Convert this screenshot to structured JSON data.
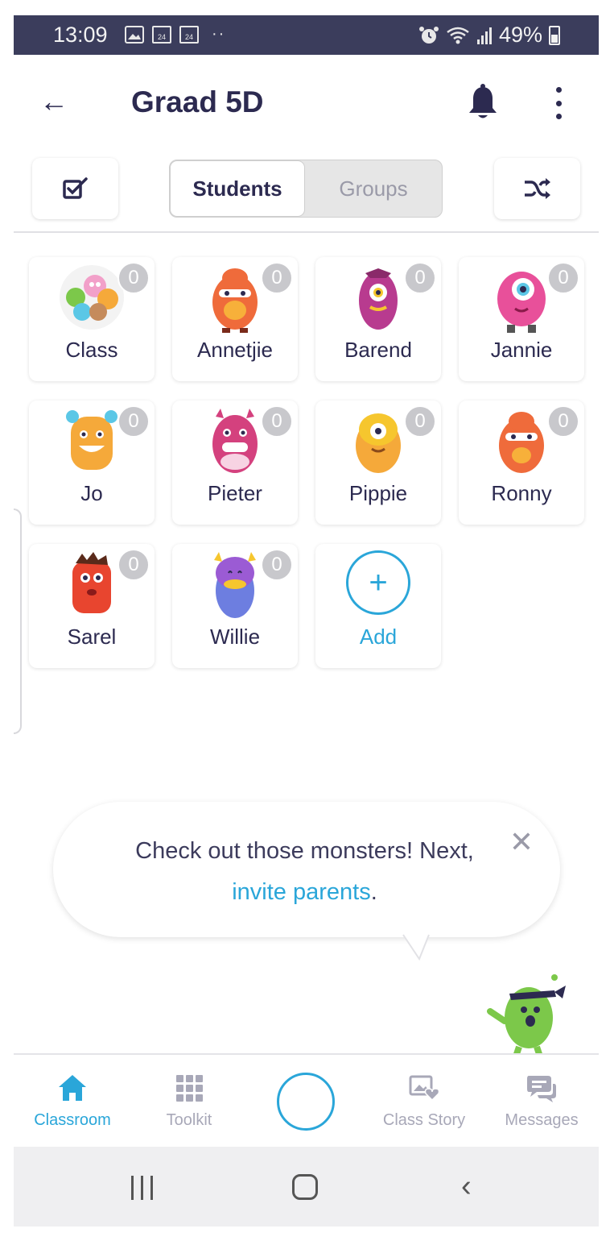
{
  "status_bar": {
    "time": "13:09",
    "left_icons": [
      "image-icon",
      "news24-icon",
      "news24-icon",
      "more-dots"
    ],
    "news24_text": "24",
    "dots": "··",
    "battery": "49%",
    "right_icons": [
      "alarm-icon",
      "wifi-icon",
      "signal-icon",
      "battery-icon"
    ]
  },
  "header": {
    "back_icon": "←",
    "title": "Graad 5D",
    "bell_icon": "bell-icon",
    "more_icon": "more-vertical-icon"
  },
  "toolbar": {
    "select_icon": "checkbox-edit-icon",
    "tabs": [
      {
        "label": "Students",
        "active": true
      },
      {
        "label": "Groups",
        "active": false
      }
    ],
    "shuffle_icon": "shuffle-icon"
  },
  "students": [
    {
      "name": "Class",
      "points": "0",
      "avatar": "class-group",
      "color": "#f2a0c9"
    },
    {
      "name": "Annetjie",
      "points": "0",
      "avatar": "monster",
      "color": "#ef6b3b"
    },
    {
      "name": "Barend",
      "points": "0",
      "avatar": "monster",
      "color": "#b83b8f"
    },
    {
      "name": "Jannie",
      "points": "0",
      "avatar": "monster",
      "color": "#e8509a"
    },
    {
      "name": "Jo",
      "points": "0",
      "avatar": "monster",
      "color": "#f5a93a"
    },
    {
      "name": "Pieter",
      "points": "0",
      "avatar": "monster",
      "color": "#d4417e"
    },
    {
      "name": "Pippie",
      "points": "0",
      "avatar": "monster",
      "color": "#f6c62e"
    },
    {
      "name": "Ronny",
      "points": "0",
      "avatar": "monster",
      "color": "#ef6b3b"
    },
    {
      "name": "Sarel",
      "points": "0",
      "avatar": "monster",
      "color": "#e8452f"
    },
    {
      "name": "Willie",
      "points": "0",
      "avatar": "monster",
      "color": "#9b5bd4"
    }
  ],
  "add_card": {
    "icon": "+",
    "label": "Add"
  },
  "bubble": {
    "text_before": "Check out those monsters! Next,",
    "link": "invite parents",
    "text_after": ".",
    "close": "✕"
  },
  "bottom_nav": {
    "items": [
      {
        "label": "Classroom",
        "icon": "home-icon",
        "active": true
      },
      {
        "label": "Toolkit",
        "icon": "grid-icon",
        "active": false
      },
      {
        "label": "Class Story",
        "icon": "photo-heart-icon",
        "active": false
      },
      {
        "label": "Messages",
        "icon": "chat-icon",
        "active": false
      }
    ]
  },
  "colors": {
    "accent": "#2aa6d9",
    "text": "#2c2a50",
    "status_bar": "#3b3d5c",
    "inactive": "#a8a8b8"
  }
}
